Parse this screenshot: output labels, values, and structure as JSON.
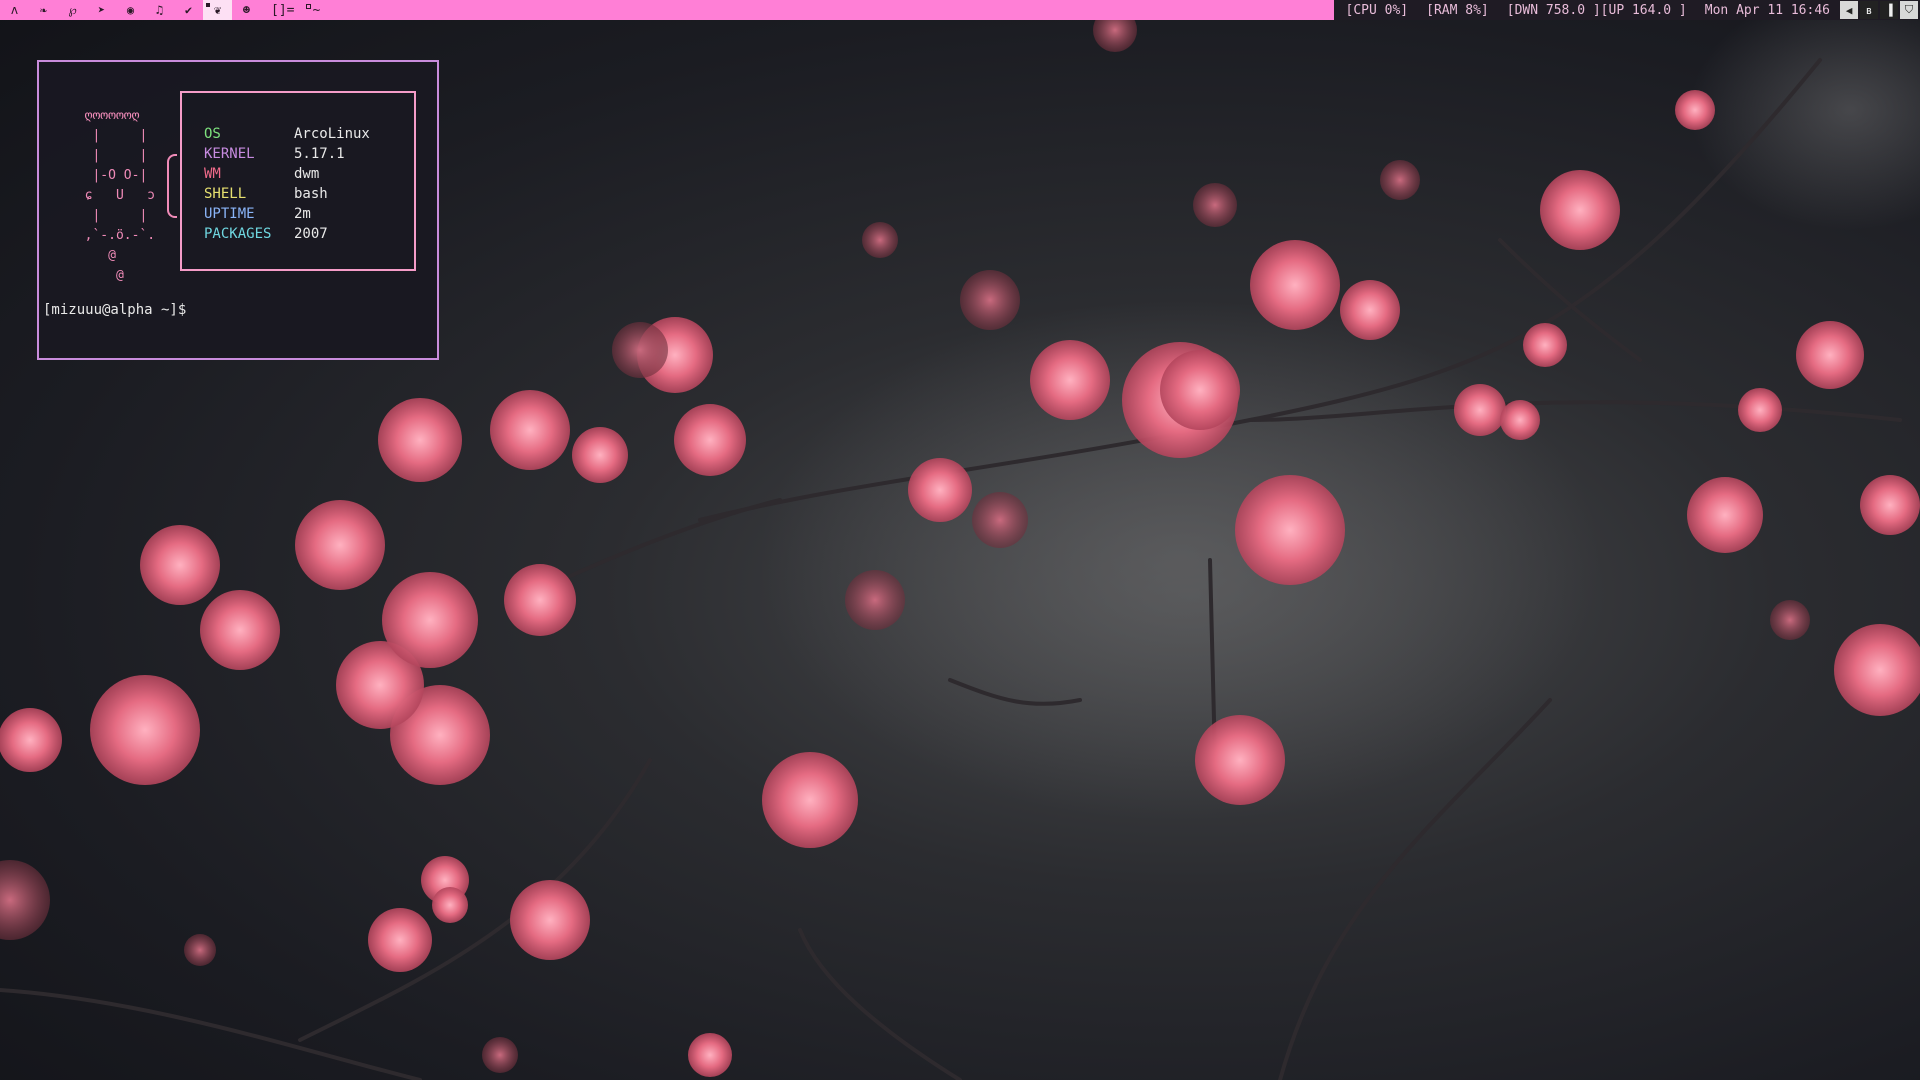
{
  "bar": {
    "tags": [
      {
        "icon": "arch-icon",
        "glyph": "ʌ"
      },
      {
        "icon": "bird-icon",
        "glyph": "❧"
      },
      {
        "icon": "leaf-icon",
        "glyph": "℘"
      },
      {
        "icon": "paper-plane-icon",
        "glyph": "➤"
      },
      {
        "icon": "game-controller-icon",
        "glyph": "◉"
      },
      {
        "icon": "music-icon",
        "glyph": "♫"
      },
      {
        "icon": "check-icon",
        "glyph": "✔"
      },
      {
        "icon": "cat-icon",
        "glyph": "❦"
      },
      {
        "icon": "face-icon",
        "glyph": "☻"
      }
    ],
    "layout": "[]=",
    "window_title": "~",
    "status": {
      "cpu": "[CPU 0%]",
      "ram": "[RAM 8%]",
      "net": "[DWN 758.0 ][UP 164.0 ]",
      "datetime": "Mon Apr 11 16:46"
    },
    "tray": [
      {
        "icon": "volume-icon",
        "glyph": "◀"
      },
      {
        "icon": "bluetooth-icon",
        "glyph": "ʙ"
      },
      {
        "icon": "signal-icon",
        "glyph": "▐"
      },
      {
        "icon": "shield-icon",
        "glyph": "⛉"
      }
    ]
  },
  "terminal": {
    "ascii_art": "  ღოოოოოღ\n   |     |\n   |     |\n   |-O O-|\n  ɕ   U   ɔ\n   |     |\n  ,`-.ö.-`.\n     @\n      @",
    "info": [
      {
        "key": "OS",
        "value": "ArcoLinux",
        "color": "#7ee27e"
      },
      {
        "key": "KERNEL",
        "value": "5.17.1",
        "color": "#c78be0"
      },
      {
        "key": "WM",
        "value": "dwm",
        "color": "#f06a8a"
      },
      {
        "key": "SHELL",
        "value": "bash",
        "color": "#e6e070"
      },
      {
        "key": "UPTIME",
        "value": "2m",
        "color": "#8ab4f8"
      },
      {
        "key": "PACKAGES",
        "value": "2007",
        "color": "#6fd6e0"
      }
    ],
    "prompt": "[mizuuu@alpha ~]$"
  },
  "colors": {
    "accent": "#ff7fd6",
    "terminal_border": "#c98cdc",
    "info_border": "#f59cc8",
    "ascii": "#f08bb8"
  }
}
